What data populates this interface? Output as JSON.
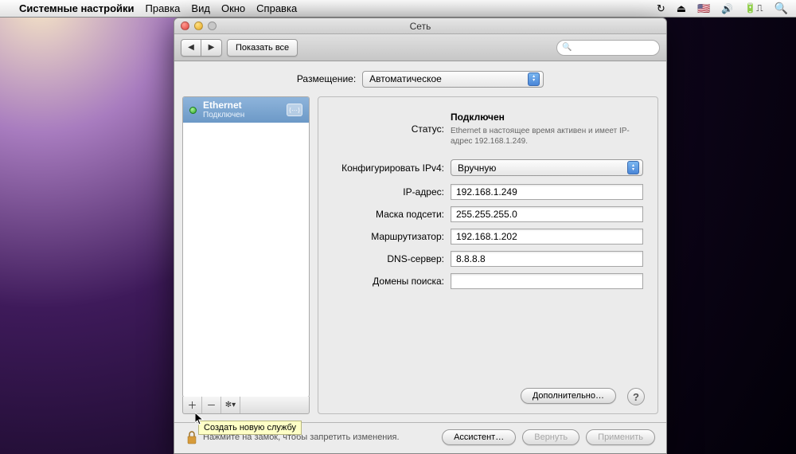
{
  "menubar": {
    "app": "Системные настройки",
    "items": [
      "Правка",
      "Вид",
      "Окно",
      "Справка"
    ],
    "flag": "🇺🇸"
  },
  "window": {
    "title": "Сеть",
    "toolbar": {
      "show_all": "Показать все",
      "search_placeholder": ""
    },
    "location": {
      "label": "Размещение:",
      "value": "Автоматическое"
    },
    "sidebar": {
      "services": [
        {
          "name": "Ethernet",
          "status": "Подключен",
          "connected": true
        }
      ],
      "add_tooltip": "Создать новую службу"
    },
    "panel": {
      "status_label": "Статус:",
      "status_value": "Подключен",
      "status_desc": "Ethernet в настоящее время активен и имеет IP-адрес 192.168.1.249.",
      "configure_label": "Конфигурировать IPv4:",
      "configure_value": "Вручную",
      "fields": {
        "ip": {
          "label": "IP-адрес:",
          "value": "192.168.1.249"
        },
        "mask": {
          "label": "Маска подсети:",
          "value": "255.255.255.0"
        },
        "router": {
          "label": "Маршрутизатор:",
          "value": "192.168.1.202"
        },
        "dns": {
          "label": "DNS-сервер:",
          "value": "8.8.8.8"
        },
        "search": {
          "label": "Домены поиска:",
          "value": ""
        }
      },
      "advanced": "Дополнительно…"
    },
    "footer": {
      "lock_text": "Нажмите на замок, чтобы запретить изменения.",
      "assist": "Ассистент…",
      "revert": "Вернуть",
      "apply": "Применить"
    }
  }
}
